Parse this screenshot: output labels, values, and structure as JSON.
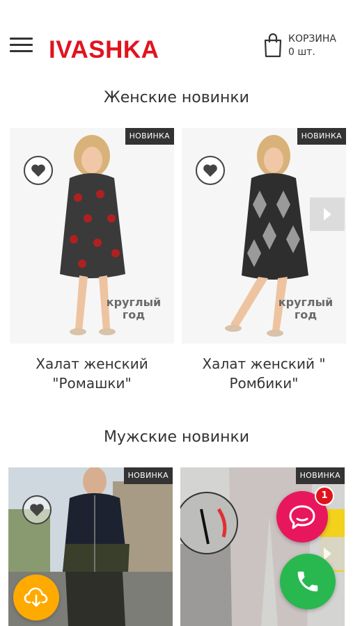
{
  "header": {
    "logo": "IVASHKA",
    "cart_label": "КОРЗИНА",
    "cart_count": "0 шт."
  },
  "women": {
    "title": "Женские новинки",
    "products": [
      {
        "badge": "НОВИНКА",
        "promo": "круглый год",
        "name": "Халат женский \"Ромашки\""
      },
      {
        "badge": "НОВИНКА",
        "promo": "круглый год",
        "name": "Халат женский \" Ромбики\""
      }
    ]
  },
  "men": {
    "title": "Мужские новинки",
    "products": [
      {
        "badge": "НОВИНКА"
      },
      {
        "badge": "НОВИНКА"
      }
    ]
  },
  "widgets": {
    "chat_unread": "1"
  },
  "colors": {
    "brand": "#e0141f",
    "chat": "#e8175d",
    "call": "#28b84f",
    "download": "#ffaa00"
  }
}
